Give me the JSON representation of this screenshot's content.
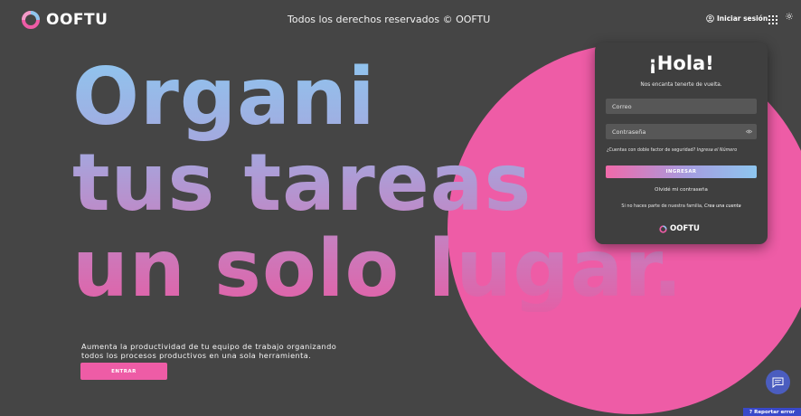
{
  "header": {
    "brand": "OOFTU",
    "rights": "Todos los derechos reservados © OOFTU",
    "login_link": "Iniciar sesión",
    "icons": [
      "user-icon",
      "apps-grid-icon",
      "sun-icon"
    ]
  },
  "hero": {
    "line1": "Organi",
    "line2": "tus tareas",
    "line3": "un solo lugar.",
    "line3_white": "lugar.",
    "subtitle_1": "Aumenta la productividad de tu equipo de trabajo organizando",
    "subtitle_2": "todos los procesos productivos en una sola herramienta.",
    "enter_label": "ENTRAR"
  },
  "login_card": {
    "title": "¡Hola!",
    "subtitle": "Nos encanta tenerte de vuelta.",
    "email_placeholder": "Correo",
    "password_placeholder": "Contraseña",
    "twofa_text": "¿Cuentas con doble factor de seguridad?",
    "twofa_link": "Ingresa el Número",
    "login_label": "INGRESAR",
    "forgot_label": "Olvidé mi contraseña",
    "signup_text": "Si no haces parte de nuestra familia,",
    "signup_link": "Crea una cuenta",
    "brand": "OOFTU"
  },
  "report": {
    "label": "Reportar error",
    "icon": "question-icon"
  },
  "colors": {
    "background": "#454545",
    "pink": "#ee5ca6",
    "blue": "#8ec6ef",
    "card": "#3f3f3f",
    "chat": "#4b5dbf"
  }
}
